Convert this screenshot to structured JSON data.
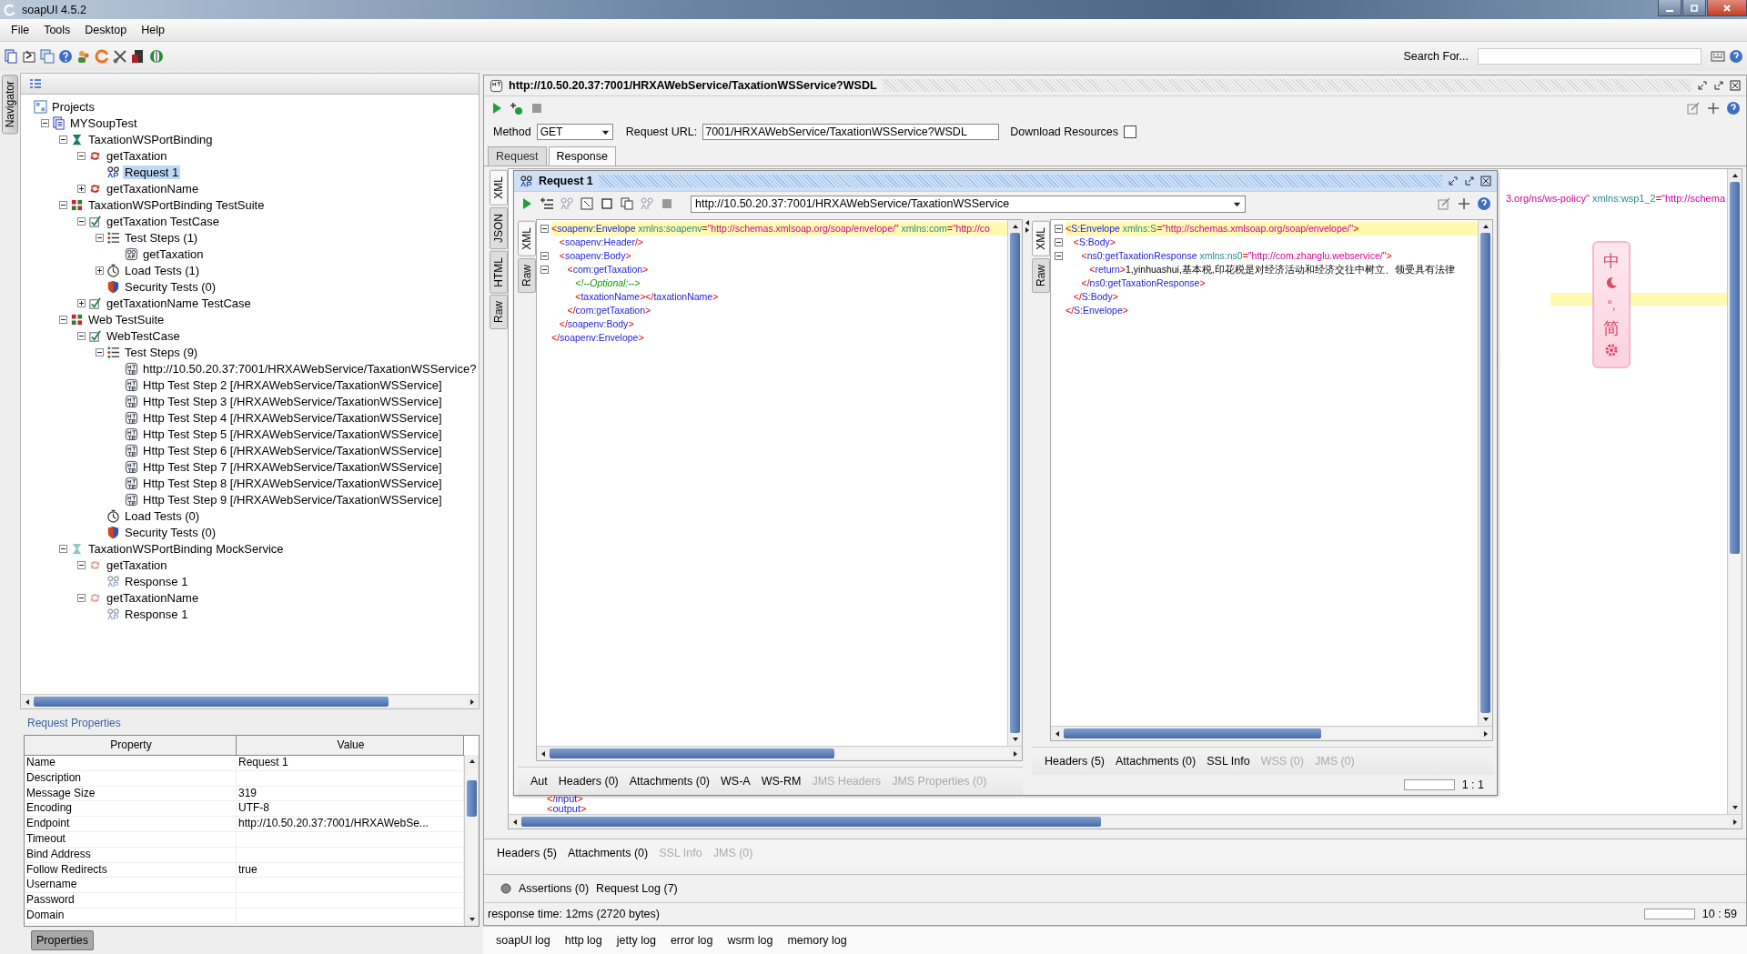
{
  "window": {
    "title": "soapUI 4.5.2"
  },
  "menu": [
    "File",
    "Tools",
    "Desktop",
    "Help"
  ],
  "search": {
    "label": "Search For..."
  },
  "navigator": {
    "tab": "Navigator",
    "tree": [
      {
        "label": "Projects",
        "kind": "projects",
        "expandable": false,
        "selected": false,
        "children": [
          {
            "label": "MYSoupTest",
            "kind": "project",
            "expandable": true,
            "expanded": true,
            "selected": false,
            "children": [
              {
                "label": "TaxationWSPortBinding",
                "kind": "interface",
                "expandable": true,
                "expanded": true,
                "selected": false,
                "children": [
                  {
                    "label": "getTaxation",
                    "kind": "operation",
                    "expandable": true,
                    "expanded": true,
                    "selected": false,
                    "children": [
                      {
                        "label": "Request 1",
                        "kind": "request",
                        "expandable": false,
                        "selected": true
                      }
                    ]
                  },
                  {
                    "label": "getTaxationName",
                    "kind": "operation",
                    "expandable": true,
                    "expanded": false,
                    "selected": false
                  }
                ]
              },
              {
                "label": "TaxationWSPortBinding TestSuite",
                "kind": "testsuite",
                "expandable": true,
                "expanded": true,
                "selected": false,
                "children": [
                  {
                    "label": "getTaxation TestCase",
                    "kind": "testcase",
                    "expandable": true,
                    "expanded": true,
                    "selected": false,
                    "children": [
                      {
                        "label": "Test Steps (1)",
                        "kind": "steps",
                        "expandable": true,
                        "expanded": true,
                        "selected": false,
                        "children": [
                          {
                            "label": "getTaxation",
                            "kind": "soap-step",
                            "expandable": false,
                            "selected": false
                          }
                        ]
                      },
                      {
                        "label": "Load Tests (1)",
                        "kind": "loadtest",
                        "expandable": true,
                        "expanded": false,
                        "selected": false
                      },
                      {
                        "label": "Security Tests (0)",
                        "kind": "security",
                        "expandable": false,
                        "selected": false
                      }
                    ]
                  },
                  {
                    "label": "getTaxationName TestCase",
                    "kind": "testcase",
                    "expandable": true,
                    "expanded": false,
                    "selected": false
                  }
                ]
              },
              {
                "label": "Web TestSuite",
                "kind": "testsuite",
                "expandable": true,
                "expanded": true,
                "selected": false,
                "children": [
                  {
                    "label": "WebTestCase",
                    "kind": "testcase",
                    "expandable": true,
                    "expanded": true,
                    "selected": false,
                    "children": [
                      {
                        "label": "Test Steps (9)",
                        "kind": "steps",
                        "expandable": true,
                        "expanded": true,
                        "selected": false,
                        "children": [
                          {
                            "label": "http://10.50.20.37:7001/HRXAWebService/TaxationWSService?",
                            "kind": "http-step",
                            "expandable": false,
                            "selected": false
                          },
                          {
                            "label": "Http Test Step 2 [/HRXAWebService/TaxationWSService]",
                            "kind": "http-step",
                            "expandable": false,
                            "selected": false
                          },
                          {
                            "label": "Http Test Step 3 [/HRXAWebService/TaxationWSService]",
                            "kind": "http-step",
                            "expandable": false,
                            "selected": false
                          },
                          {
                            "label": "Http Test Step 4 [/HRXAWebService/TaxationWSService]",
                            "kind": "http-step",
                            "expandable": false,
                            "selected": false
                          },
                          {
                            "label": "Http Test Step 5 [/HRXAWebService/TaxationWSService]",
                            "kind": "http-step",
                            "expandable": false,
                            "selected": false
                          },
                          {
                            "label": "Http Test Step 6 [/HRXAWebService/TaxationWSService]",
                            "kind": "http-step",
                            "expandable": false,
                            "selected": false
                          },
                          {
                            "label": "Http Test Step 7 [/HRXAWebService/TaxationWSService]",
                            "kind": "http-step",
                            "expandable": false,
                            "selected": false
                          },
                          {
                            "label": "Http Test Step 8 [/HRXAWebService/TaxationWSService]",
                            "kind": "http-step",
                            "expandable": false,
                            "selected": false
                          },
                          {
                            "label": "Http Test Step 9 [/HRXAWebService/TaxationWSService]",
                            "kind": "http-step",
                            "expandable": false,
                            "selected": false
                          }
                        ]
                      },
                      {
                        "label": "Load Tests (0)",
                        "kind": "loadtest",
                        "expandable": false,
                        "selected": false
                      },
                      {
                        "label": "Security Tests (0)",
                        "kind": "security",
                        "expandable": false,
                        "selected": false
                      }
                    ]
                  }
                ]
              },
              {
                "label": "TaxationWSPortBinding MockService",
                "kind": "mock",
                "expandable": true,
                "expanded": true,
                "selected": false,
                "children": [
                  {
                    "label": "getTaxation",
                    "kind": "mock-op",
                    "expandable": true,
                    "expanded": true,
                    "selected": false,
                    "children": [
                      {
                        "label": "Response 1",
                        "kind": "response",
                        "expandable": false,
                        "selected": false
                      }
                    ]
                  },
                  {
                    "label": "getTaxationName",
                    "kind": "mock-op",
                    "expandable": true,
                    "expanded": true,
                    "selected": false,
                    "children": [
                      {
                        "label": "Response 1",
                        "kind": "response",
                        "expandable": false,
                        "selected": false
                      }
                    ]
                  }
                ]
              }
            ]
          }
        ]
      }
    ]
  },
  "request_properties": {
    "title": "Request Properties",
    "columns": [
      "Property",
      "Value"
    ],
    "rows": [
      {
        "property": "Name",
        "value": "Request 1"
      },
      {
        "property": "Description"
      },
      {
        "property": "Message Size",
        "value": "319"
      },
      {
        "property": "Encoding",
        "value": "UTF-8"
      },
      {
        "property": "Endpoint",
        "value": "http://10.50.20.37:7001/HRXAWebSe..."
      },
      {
        "property": "Timeout"
      },
      {
        "property": "Bind Address"
      },
      {
        "property": "Follow Redirects",
        "value": "true"
      },
      {
        "property": "Username"
      },
      {
        "property": "Password"
      },
      {
        "property": "Domain"
      }
    ]
  },
  "left_tabs": [
    {
      "label": "Properties",
      "selected": true
    }
  ],
  "editor": {
    "title": "http://10.50.20.37:7001/HRXAWebService/TaxationWSService?WSDL",
    "method_label": "Method",
    "method": "GET",
    "url_label": "Request URL:",
    "url": "7001/HRXAWebService/TaxationWSService?WSDL",
    "download_label": "Download Resources",
    "download_checked": false,
    "tabs": [
      {
        "label": "Request",
        "selected": false
      },
      {
        "label": "Response",
        "selected": true
      }
    ],
    "side_tabs": [
      {
        "label": "XML",
        "selected": true
      },
      {
        "label": "JSON",
        "selected": false
      },
      {
        "label": "HTML",
        "selected": false
      },
      {
        "label": "Raw",
        "selected": false
      }
    ],
    "background_top": [
      {
        "kind": "value",
        "text": "3.org/ns/ws-policy\""
      },
      {
        "kind": "attr",
        "text": " xmlns:wsp1_2"
      },
      {
        "kind": "punct",
        "text": "="
      },
      {
        "kind": "value",
        "text": "\"http://schema"
      }
    ],
    "background_bottom": [
      [
        {
          "kind": "punct",
          "text": "</"
        },
        {
          "kind": "tag",
          "text": "input"
        },
        {
          "kind": "punct",
          "text": ">"
        }
      ],
      [
        {
          "kind": "punct",
          "text": "<"
        },
        {
          "kind": "tag",
          "text": "output"
        },
        {
          "kind": "punct",
          "text": ">"
        }
      ]
    ],
    "bottom_tabs": [
      {
        "label": "Headers (5)",
        "disabled": false
      },
      {
        "label": "Attachments (0)",
        "disabled": false
      },
      {
        "label": "SSL Info",
        "disabled": true
      },
      {
        "label": "JMS (0)",
        "disabled": true
      }
    ],
    "inspector_tabs": [
      {
        "label": "Assertions (0)",
        "kind": "assertions"
      },
      {
        "label": "Request Log (7)",
        "kind": "log"
      }
    ],
    "status": "response time: 12ms (2720 bytes)",
    "position": "10 : 59"
  },
  "request_window": {
    "title": "Request 1",
    "url": "http://10.50.20.37:7001/HRXAWebService/TaxationWSService",
    "request": {
      "side_tabs": [
        {
          "label": "XML",
          "selected": true
        },
        {
          "label": "Raw",
          "selected": false
        }
      ],
      "lines": [
        {
          "fold": true,
          "highlight": true,
          "segments": [
            {
              "kind": "punct",
              "text": "<"
            },
            {
              "kind": "tag",
              "text": "soapenv:Envelope"
            },
            {
              "kind": "attr",
              "text": " xmlns:soapenv"
            },
            {
              "kind": "punct",
              "text": "="
            },
            {
              "kind": "value",
              "text": "\"http://schemas.xmlsoap.org/soap/envelope/\""
            },
            {
              "kind": "attr",
              "text": " xmlns:com"
            },
            {
              "kind": "punct",
              "text": "="
            },
            {
              "kind": "value",
              "text": "\"http://co"
            }
          ]
        },
        {
          "fold": false,
          "highlight": false,
          "segments": [
            {
              "kind": "punct",
              "text": "   <"
            },
            {
              "kind": "tag",
              "text": "soapenv:Header"
            },
            {
              "kind": "punct",
              "text": "/>"
            }
          ]
        },
        {
          "fold": true,
          "highlight": false,
          "segments": [
            {
              "kind": "punct",
              "text": "   <"
            },
            {
              "kind": "tag",
              "text": "soapenv:Body"
            },
            {
              "kind": "punct",
              "text": ">"
            }
          ]
        },
        {
          "fold": true,
          "highlight": false,
          "segments": [
            {
              "kind": "punct",
              "text": "      <"
            },
            {
              "kind": "tag",
              "text": "com:getTaxation"
            },
            {
              "kind": "punct",
              "text": ">"
            }
          ]
        },
        {
          "fold": false,
          "highlight": false,
          "segments": [
            {
              "kind": "comment",
              "text": "         <!--Optional:-->"
            }
          ]
        },
        {
          "fold": false,
          "highlight": false,
          "segments": [
            {
              "kind": "punct",
              "text": "         <"
            },
            {
              "kind": "tag",
              "text": "taxationName"
            },
            {
              "kind": "punct",
              "text": "></"
            },
            {
              "kind": "tag",
              "text": "taxationName"
            },
            {
              "kind": "punct",
              "text": ">"
            }
          ]
        },
        {
          "fold": false,
          "highlight": false,
          "segments": [
            {
              "kind": "punct",
              "text": "      </"
            },
            {
              "kind": "tag",
              "text": "com:getTaxation"
            },
            {
              "kind": "punct",
              "text": ">"
            }
          ]
        },
        {
          "fold": false,
          "highlight": false,
          "segments": [
            {
              "kind": "punct",
              "text": "   </"
            },
            {
              "kind": "tag",
              "text": "soapenv:Body"
            },
            {
              "kind": "punct",
              "text": ">"
            }
          ]
        },
        {
          "fold": false,
          "highlight": false,
          "segments": [
            {
              "kind": "punct",
              "text": "</"
            },
            {
              "kind": "tag",
              "text": "soapenv:Envelope"
            },
            {
              "kind": "punct",
              "text": ">"
            }
          ]
        }
      ],
      "tabs": [
        {
          "label": "Aut",
          "disabled": false
        },
        {
          "label": "Headers (0)",
          "disabled": false
        },
        {
          "label": "Attachments (0)",
          "disabled": false
        },
        {
          "label": "WS-A",
          "disabled": false
        },
        {
          "label": "WS-RM",
          "disabled": false
        },
        {
          "label": "JMS Headers",
          "disabled": true
        },
        {
          "label": "JMS Properties (0)",
          "disabled": true
        }
      ]
    },
    "response": {
      "side_tabs": [
        {
          "label": "XML",
          "selected": true
        },
        {
          "label": "Raw",
          "selected": false
        }
      ],
      "lines": [
        {
          "fold": true,
          "highlight": true,
          "segments": [
            {
              "kind": "punct",
              "text": "<"
            },
            {
              "kind": "tag",
              "text": "S:Envelope"
            },
            {
              "kind": "attr",
              "text": " xmlns:S"
            },
            {
              "kind": "punct",
              "text": "="
            },
            {
              "kind": "value",
              "text": "\"http://schemas.xmlsoap.org/soap/envelope/\""
            },
            {
              "kind": "punct",
              "text": ">"
            }
          ]
        },
        {
          "fold": true,
          "highlight": false,
          "segments": [
            {
              "kind": "punct",
              "text": "   <"
            },
            {
              "kind": "tag",
              "text": "S:Body"
            },
            {
              "kind": "punct",
              "text": ">"
            }
          ]
        },
        {
          "fold": true,
          "highlight": false,
          "segments": [
            {
              "kind": "punct",
              "text": "      <"
            },
            {
              "kind": "tag",
              "text": "ns0:getTaxationResponse"
            },
            {
              "kind": "attr",
              "text": " xmlns:ns0"
            },
            {
              "kind": "punct",
              "text": "="
            },
            {
              "kind": "value",
              "text": "\"http://com.zhanglu.webservice/\""
            },
            {
              "kind": "punct",
              "text": ">"
            }
          ]
        },
        {
          "fold": false,
          "highlight": false,
          "segments": [
            {
              "kind": "punct",
              "text": "         <"
            },
            {
              "kind": "tag",
              "text": "return"
            },
            {
              "kind": "punct",
              "text": ">"
            },
            {
              "kind": "text",
              "text": "1,yinhuashui,基本税,印花税是对经济活动和经济交往中树立、领受具有法律"
            }
          ]
        },
        {
          "fold": false,
          "highlight": false,
          "segments": [
            {
              "kind": "punct",
              "text": "      </"
            },
            {
              "kind": "tag",
              "text": "ns0:getTaxationResponse"
            },
            {
              "kind": "punct",
              "text": ">"
            }
          ]
        },
        {
          "fold": false,
          "highlight": false,
          "segments": [
            {
              "kind": "punct",
              "text": "   </"
            },
            {
              "kind": "tag",
              "text": "S:Body"
            },
            {
              "kind": "punct",
              "text": ">"
            }
          ]
        },
        {
          "fold": false,
          "highlight": false,
          "segments": [
            {
              "kind": "punct",
              "text": "</"
            },
            {
              "kind": "tag",
              "text": "S:Envelope"
            },
            {
              "kind": "punct",
              "text": ">"
            }
          ]
        }
      ],
      "tabs": [
        {
          "label": "Headers (5)",
          "disabled": false
        },
        {
          "label": "Attachments (0)",
          "disabled": false
        },
        {
          "label": "SSL Info",
          "disabled": false
        },
        {
          "label": "WSS (0)",
          "disabled": true
        },
        {
          "label": "JMS (0)",
          "disabled": true
        }
      ],
      "position": "1 : 1"
    }
  },
  "log_tabs": [
    "soapUI log",
    "http log",
    "jetty log",
    "error log",
    "wsrm log",
    "memory log"
  ],
  "ime_toolbar": {
    "labels": [
      "中",
      "°,",
      "简"
    ]
  }
}
